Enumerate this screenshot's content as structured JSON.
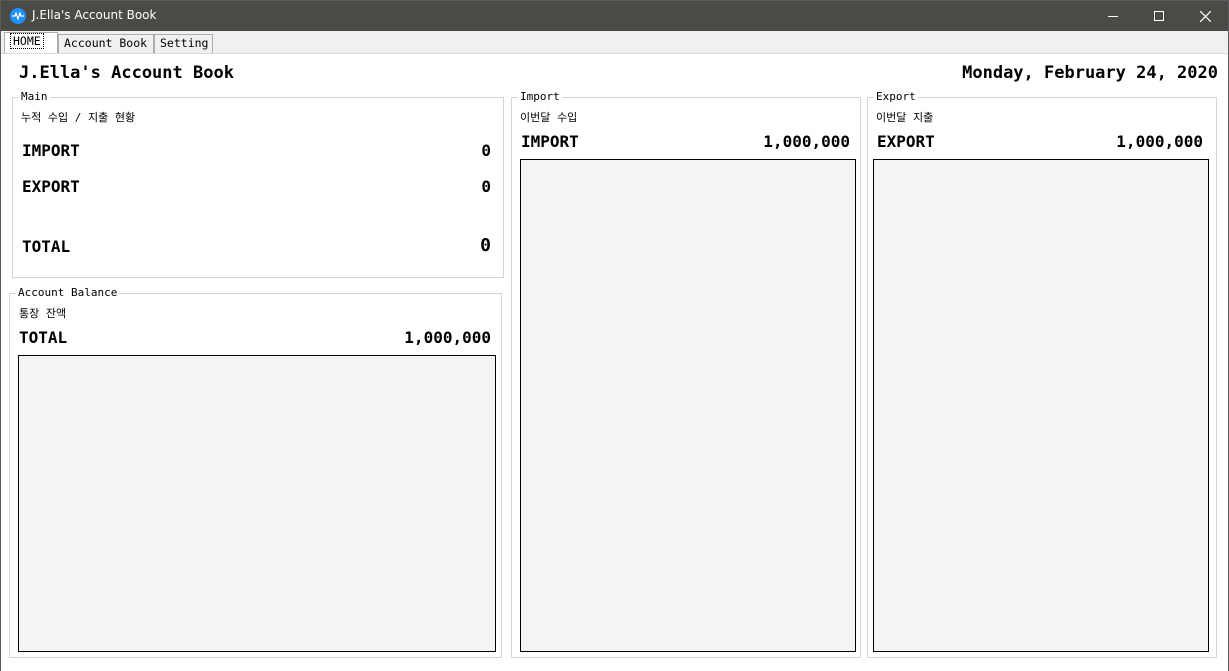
{
  "window": {
    "title": "J.Ella's Account Book"
  },
  "tabs": [
    "HOME",
    "Account Book",
    "Setting"
  ],
  "header": {
    "title": "J.Ella's Account Book",
    "date": "Monday, February 24, 2020"
  },
  "main": {
    "legend": "Main",
    "subtitle": "누적 수입 / 지출 현황",
    "import_label": "IMPORT",
    "import_value": "0",
    "export_label": "EXPORT",
    "export_value": "0",
    "total_label": "TOTAL",
    "total_value": "0"
  },
  "balance": {
    "legend": "Account Balance",
    "subtitle": "통장 잔액",
    "total_label": "TOTAL",
    "total_value": "1,000,000"
  },
  "import": {
    "legend": "Import",
    "subtitle": "이번달 수입",
    "label": "IMPORT",
    "value": "1,000,000"
  },
  "export": {
    "legend": "Export",
    "subtitle": "이번달 지출",
    "label": "EXPORT",
    "value": "1,000,000"
  }
}
